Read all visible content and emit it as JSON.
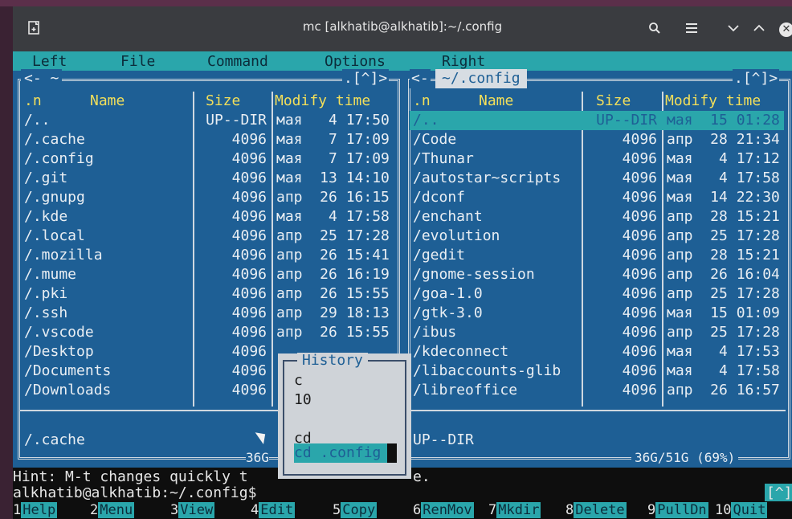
{
  "window": {
    "title": "mc [alkhatib@alkhatib]:~/.config",
    "icons": [
      "terminal-tab-icon",
      "search-icon",
      "menu-icon",
      "chevron-down-icon",
      "chevron-up-icon",
      "close-icon"
    ]
  },
  "menubar": {
    "items": [
      "Left",
      "File",
      "Command",
      "Options",
      "Right"
    ]
  },
  "left_panel": {
    "header_path": "<- ~",
    "header_right": ".[^]>",
    "columns": {
      "n": ".n",
      "name": "Name",
      "size": "Size",
      "modify": "Modify time"
    },
    "rows": [
      {
        "name": "/..",
        "size": "UP--DIR",
        "time": "мая   4 17:50"
      },
      {
        "name": "/.cache",
        "size": "4096",
        "time": "мая   7 17:09"
      },
      {
        "name": "/.config",
        "size": "4096",
        "time": "мая   7 17:09"
      },
      {
        "name": "/.git",
        "size": "4096",
        "time": "мая  13 14:10"
      },
      {
        "name": "/.gnupg",
        "size": "4096",
        "time": "апр  26 16:15"
      },
      {
        "name": "/.kde",
        "size": "4096",
        "time": "мая   4 17:58"
      },
      {
        "name": "/.local",
        "size": "4096",
        "time": "апр  25 17:28"
      },
      {
        "name": "/.mozilla",
        "size": "4096",
        "time": "апр  26 15:41"
      },
      {
        "name": "/.mume",
        "size": "4096",
        "time": "апр  26 16:19"
      },
      {
        "name": "/.pki",
        "size": "4096",
        "time": "апр  26 15:55"
      },
      {
        "name": "/.ssh",
        "size": "4096",
        "time": "апр  29 18:13"
      },
      {
        "name": "/.vscode",
        "size": "4096",
        "time": "апр  26 15:55"
      },
      {
        "name": "/Desktop",
        "size": "4096",
        "time": ""
      },
      {
        "name": "/Documents",
        "size": "4096",
        "time": ""
      },
      {
        "name": "/Downloads",
        "size": "4096",
        "time": ""
      }
    ],
    "status_name": "/.cache",
    "footer": "36G"
  },
  "right_panel": {
    "header_path": "~/.config",
    "header_right": ".[^]>",
    "columns": {
      "n": ".n",
      "name": "Name",
      "size": "Size",
      "modify": "Modify time"
    },
    "rows": [
      {
        "name": "/..",
        "size": "UP--DIR",
        "time": "мая  15 01:28"
      },
      {
        "name": "/Code",
        "size": "4096",
        "time": "апр  28 21:34"
      },
      {
        "name": "/Thunar",
        "size": "4096",
        "time": "мая   4 17:12"
      },
      {
        "name": "/autostar~scripts",
        "size": "4096",
        "time": "мая   4 17:58"
      },
      {
        "name": "/dconf",
        "size": "4096",
        "time": "мая  14 22:30"
      },
      {
        "name": "/enchant",
        "size": "4096",
        "time": "апр  28 15:21"
      },
      {
        "name": "/evolution",
        "size": "4096",
        "time": "апр  25 17:28"
      },
      {
        "name": "/gedit",
        "size": "4096",
        "time": "апр  28 15:21"
      },
      {
        "name": "/gnome-session",
        "size": "4096",
        "time": "апр  26 16:04"
      },
      {
        "name": "/goa-1.0",
        "size": "4096",
        "time": "апр  25 17:28"
      },
      {
        "name": "/gtk-3.0",
        "size": "4096",
        "time": "мая  15 01:09"
      },
      {
        "name": "/ibus",
        "size": "4096",
        "time": "апр  25 17:28"
      },
      {
        "name": "/kdeconnect",
        "size": "4096",
        "time": "мая   4 17:53"
      },
      {
        "name": "/libaccounts-glib",
        "size": "4096",
        "time": "мая   4 17:58"
      },
      {
        "name": "/libreoffice",
        "size": "4096",
        "time": "апр  26 16:57"
      }
    ],
    "status_name": "UP--DIR",
    "footer": "36G/51G (69%)"
  },
  "history_popup": {
    "title": "History",
    "items": [
      "c",
      "10",
      "",
      "cd",
      "cd .config"
    ]
  },
  "hint": "Hint: M-t changes quickly t",
  "hint_tail": "e.",
  "prompt": "alkhatib@alkhatib:~/.config$",
  "prompt_right": "[^]",
  "fkeys": [
    {
      "n": "1",
      "label": "Help"
    },
    {
      "n": "2",
      "label": "Menu"
    },
    {
      "n": "3",
      "label": "View"
    },
    {
      "n": "4",
      "label": "Edit"
    },
    {
      "n": "5",
      "label": "Copy"
    },
    {
      "n": "6",
      "label": "RenMov"
    },
    {
      "n": "7",
      "label": "Mkdir"
    },
    {
      "n": "8",
      "label": "Delete"
    },
    {
      "n": "9",
      "label": "PullDn"
    },
    {
      "n": "10",
      "label": "Quit"
    }
  ],
  "colors": {
    "panel_bg": "#1e5f95",
    "accent": "#2aa6ab",
    "header_yellow": "#f3df5a"
  }
}
